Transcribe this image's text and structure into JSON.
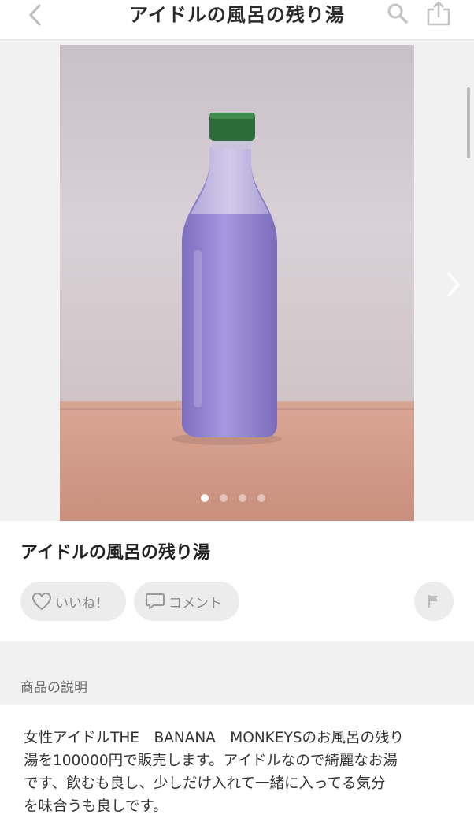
{
  "header": {
    "title": "アイドルの風呂の残り湯",
    "back_icon": "chevron-left-icon",
    "search_icon": "search-icon",
    "share_icon": "share-icon"
  },
  "gallery": {
    "photo_subject": "purple-liquid-bottle",
    "page_count": 4,
    "current_page": 1,
    "next_icon": "chevron-right-icon"
  },
  "item": {
    "title": "アイドルの風呂の残り湯"
  },
  "actions": {
    "like_label": "いいね！",
    "comment_label": "コメント",
    "like_icon": "heart-icon",
    "comment_icon": "speech-bubble-icon",
    "flag_icon": "flag-icon"
  },
  "description": {
    "section_label": "商品の説明",
    "lines": [
      "女性アイドルTHE　BANANA　MONKEYSのお風呂の残り",
      "湯を100000円で販売します。アイドルなので綺麗なお湯",
      "です、飲むも良し、少しだけ入れて一緒に入ってる気分",
      "を味合うも良しです。"
    ]
  },
  "colors": {
    "pill_bg": "#ececec",
    "section_bg": "#f1f1f1",
    "liquid": "#8b7fc9",
    "cap": "#2e6b3a"
  }
}
